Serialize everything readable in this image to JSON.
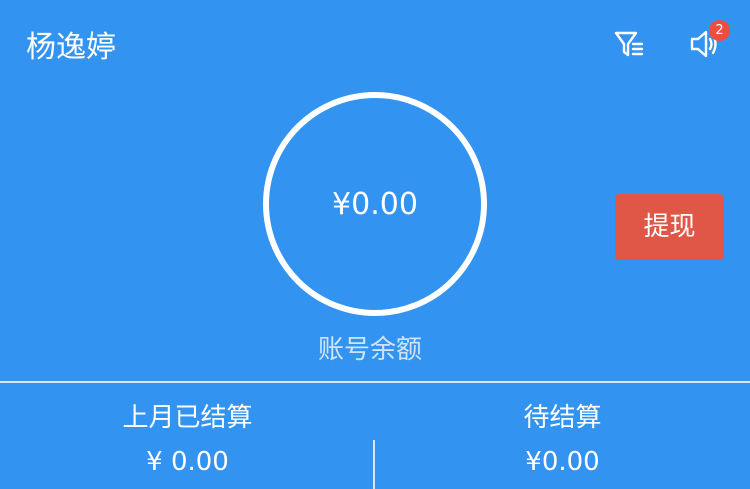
{
  "header": {
    "user_name": "杨逸婷",
    "icons": {
      "filter": "filter-icon",
      "speaker": "speaker-icon"
    },
    "notification_badge": "2"
  },
  "balance": {
    "amount": "¥0.00",
    "label": "账号余额"
  },
  "actions": {
    "withdraw_label": "提现"
  },
  "stats": {
    "last_month_title": "上月已结算",
    "last_month_value": "¥ 0.00",
    "pending_title": "待结算",
    "pending_value": "¥0.00"
  },
  "colors": {
    "background": "#3393f0",
    "withdraw_button": "#e15747",
    "badge": "#ee4e3f",
    "text": "#ffffff"
  }
}
